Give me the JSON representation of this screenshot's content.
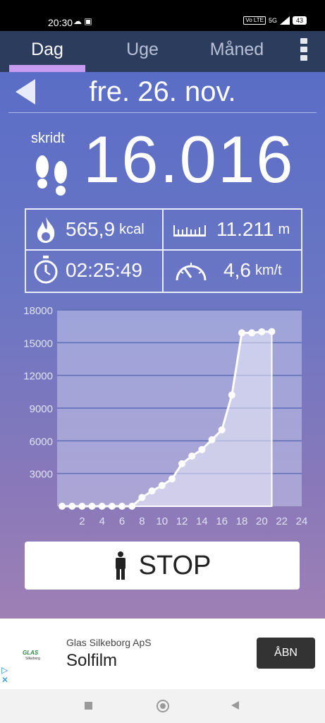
{
  "status_bar": {
    "time": "20:30",
    "signal_label": "5G",
    "volte_label": "Vo LTE",
    "battery": "43"
  },
  "tabs": [
    {
      "label": "Dag",
      "active": true
    },
    {
      "label": "Uge",
      "active": false
    },
    {
      "label": "Måned",
      "active": false
    }
  ],
  "header": {
    "date": "fre. 26. nov."
  },
  "steps": {
    "label": "skridt",
    "value": "16.016"
  },
  "stats": {
    "calories": {
      "value": "565,9",
      "unit": "kcal",
      "icon": "flame-icon"
    },
    "distance": {
      "value": "11.211",
      "unit": "m",
      "icon": "ruler-icon"
    },
    "duration": {
      "value": "02:25:49",
      "icon": "stopwatch-icon"
    },
    "speed": {
      "value": "4,6",
      "unit": "km/t",
      "icon": "speedometer-icon"
    }
  },
  "chart_data": {
    "type": "area",
    "x": [
      0,
      1,
      2,
      3,
      4,
      5,
      6,
      7,
      8,
      9,
      10,
      11,
      12,
      13,
      14,
      15,
      16,
      17,
      18,
      19,
      20,
      21
    ],
    "values": [
      0,
      0,
      0,
      0,
      0,
      0,
      0,
      0,
      800,
      1400,
      1900,
      2500,
      3900,
      4600,
      5200,
      6100,
      7000,
      10200,
      15900,
      15900,
      16000,
      16016
    ],
    "y_ticks": [
      "3000",
      "6000",
      "9000",
      "12000",
      "15000",
      "18000"
    ],
    "x_ticks": [
      "2",
      "4",
      "6",
      "8",
      "10",
      "12",
      "14",
      "16",
      "18",
      "20",
      "22",
      "24"
    ],
    "xlim": [
      -0.5,
      24
    ],
    "ylim": [
      0,
      18000
    ],
    "grid": true
  },
  "stop_button": {
    "label": "STOP",
    "icon": "person-icon"
  },
  "ad": {
    "company": "Glas Silkeborg ApS",
    "title": "Solfilm",
    "cta": "ÅBN",
    "logo_text": "GLAS Silkeborg"
  },
  "colors": {
    "tab_bar": "#2c3c5c",
    "tab_indicator": "#c79cf0",
    "accent_text": "#ffffff"
  }
}
